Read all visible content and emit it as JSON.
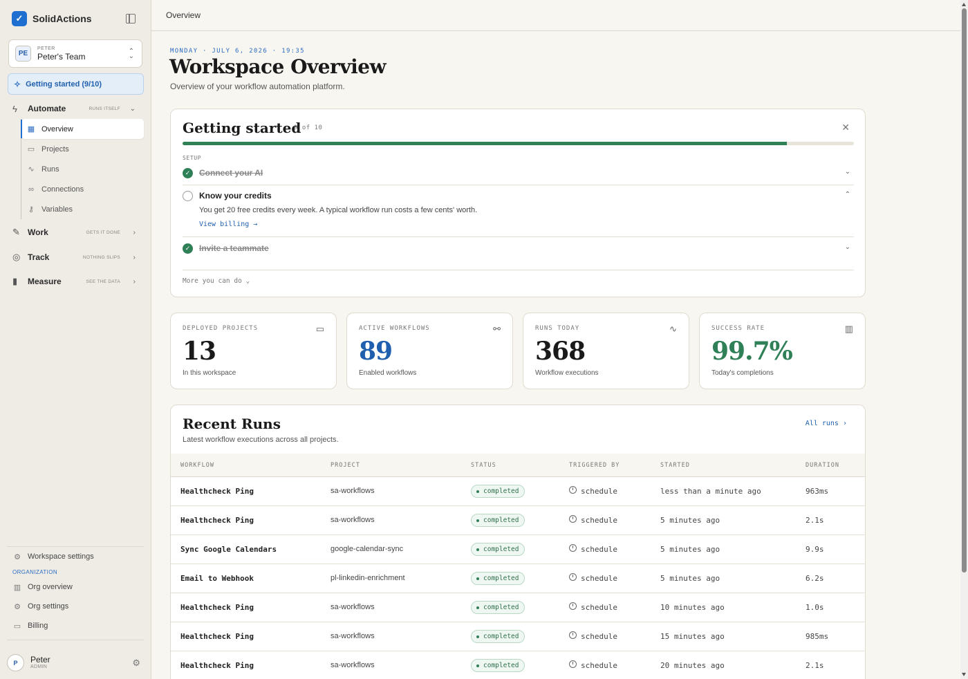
{
  "app": {
    "name": "SolidActions",
    "breadcrumb": "Overview"
  },
  "team": {
    "initials": "PE",
    "owner": "PETER",
    "name": "Peter's Team"
  },
  "sidebar": {
    "getting_started": "Getting started (9/10)",
    "sections": [
      {
        "label": "Automate",
        "tag": "RUNS ITSELF",
        "icon": "bolt-icon"
      },
      {
        "label": "Work",
        "tag": "GETS IT DONE",
        "icon": "pen-icon"
      },
      {
        "label": "Track",
        "tag": "NOTHING SLIPS",
        "icon": "target-icon"
      },
      {
        "label": "Measure",
        "tag": "SEE THE DATA",
        "icon": "bar-chart-icon"
      }
    ],
    "automate_items": [
      {
        "label": "Overview",
        "icon": "grid-icon"
      },
      {
        "label": "Projects",
        "icon": "folder-icon"
      },
      {
        "label": "Runs",
        "icon": "activity-icon"
      },
      {
        "label": "Connections",
        "icon": "link-icon"
      },
      {
        "label": "Variables",
        "icon": "key-icon"
      }
    ],
    "workspace_settings": "Workspace settings",
    "org_label": "ORGANIZATION",
    "org_items": [
      {
        "label": "Org overview",
        "icon": "building-icon"
      },
      {
        "label": "Org settings",
        "icon": "gear-icon"
      },
      {
        "label": "Billing",
        "icon": "card-icon"
      }
    ]
  },
  "user": {
    "initial": "P",
    "name": "Peter",
    "role": "ADMIN"
  },
  "header": {
    "date": "MONDAY · JULY 6, 2026 · 19:35",
    "title": "Workspace Overview",
    "subtitle": "Overview of your workflow automation platform."
  },
  "getting_started": {
    "title": "Getting started",
    "count": "9 of 10",
    "progress": 0.9,
    "section_label": "SETUP",
    "tasks": [
      {
        "label": "Connect your AI",
        "done": true
      },
      {
        "label": "Know your credits",
        "done": false,
        "description": "You get 20 free credits every week. A typical workflow run costs a few cents' worth.",
        "link": "View billing →"
      },
      {
        "label": "Invite a teammate",
        "done": true
      }
    ],
    "more": "More you can do ⌄"
  },
  "stats": [
    {
      "label": "DEPLOYED PROJECTS",
      "value": "13",
      "caption": "In this workspace",
      "icon": "folder-icon",
      "color": "#1a1a1a"
    },
    {
      "label": "ACTIVE WORKFLOWS",
      "value": "89",
      "caption": "Enabled workflows",
      "icon": "workflow-icon",
      "color": "#1f5fae"
    },
    {
      "label": "RUNS TODAY",
      "value": "368",
      "caption": "Workflow executions",
      "icon": "activity-icon",
      "color": "#1a1a1a"
    },
    {
      "label": "SUCCESS RATE",
      "value": "99.7%",
      "caption": "Today's completions",
      "icon": "bar-chart-icon",
      "color": "#2f7f57"
    }
  ],
  "recent_runs": {
    "title": "Recent Runs",
    "subtitle": "Latest workflow executions across all projects.",
    "all_link": "All runs  ›",
    "columns": [
      "WORKFLOW",
      "PROJECT",
      "STATUS",
      "TRIGGERED BY",
      "STARTED",
      "DURATION"
    ],
    "rows": [
      {
        "workflow": "Healthcheck Ping",
        "project": "sa-workflows",
        "status": "completed",
        "trigger": "schedule",
        "started": "less than a minute ago",
        "duration": "963ms"
      },
      {
        "workflow": "Healthcheck Ping",
        "project": "sa-workflows",
        "status": "completed",
        "trigger": "schedule",
        "started": "5 minutes ago",
        "duration": "2.1s"
      },
      {
        "workflow": "Sync Google Calendars",
        "project": "google-calendar-sync",
        "status": "completed",
        "trigger": "schedule",
        "started": "5 minutes ago",
        "duration": "9.9s"
      },
      {
        "workflow": "Email to Webhook",
        "project": "pl-linkedin-enrichment",
        "status": "completed",
        "trigger": "schedule",
        "started": "5 minutes ago",
        "duration": "6.2s"
      },
      {
        "workflow": "Healthcheck Ping",
        "project": "sa-workflows",
        "status": "completed",
        "trigger": "schedule",
        "started": "10 minutes ago",
        "duration": "1.0s"
      },
      {
        "workflow": "Healthcheck Ping",
        "project": "sa-workflows",
        "status": "completed",
        "trigger": "schedule",
        "started": "15 minutes ago",
        "duration": "985ms"
      },
      {
        "workflow": "Healthcheck Ping",
        "project": "sa-workflows",
        "status": "completed",
        "trigger": "schedule",
        "started": "20 minutes ago",
        "duration": "2.1s"
      }
    ]
  }
}
